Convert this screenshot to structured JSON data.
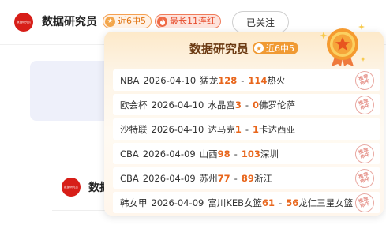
{
  "header": {
    "avatar_text": "数据研究员",
    "username": "数据研究员",
    "streak_badge": "近6中5",
    "longest_badge": "最长11连红",
    "follow_label": "已关注"
  },
  "second_post": {
    "avatar_text": "数据研究员",
    "username": "数据"
  },
  "popover": {
    "title": "数据研究员",
    "badge": "近6中5",
    "records": [
      {
        "league": "NBA",
        "date": "2026-04-10",
        "home": "猛龙",
        "home_score": "128",
        "away_score": "114",
        "away": "热火",
        "stamp": "推荐命中"
      },
      {
        "league": "欧会杯",
        "date": "2026-04-10",
        "home": "水晶宫",
        "home_score": "3",
        "away_score": "0",
        "away": "佛罗伦萨",
        "stamp": "推荐命中"
      },
      {
        "league": "沙特联",
        "date": "2026-04-10",
        "home": "达马克",
        "home_score": "1",
        "away_score": "1",
        "away": "卡达西亚",
        "stamp": ""
      },
      {
        "league": "CBA",
        "date": "2026-04-09",
        "home": "山西",
        "home_score": "98",
        "away_score": "103",
        "away": "深圳",
        "stamp": "推荐命中"
      },
      {
        "league": "CBA",
        "date": "2026-04-09",
        "home": "苏州",
        "home_score": "77",
        "away_score": "89",
        "away": "浙江",
        "stamp": "推荐命中"
      },
      {
        "league": "韩女甲",
        "date": "2026-04-09",
        "home": "富川KEB女篮",
        "home_score": "61",
        "away_score": "56",
        "away": "龙仁三星女篮",
        "stamp": "推荐命中"
      }
    ]
  },
  "colors": {
    "score": "#e8661c",
    "badge_orange": "#f09a33",
    "avatar_red": "#d71e18",
    "title_brown": "#6b3a12"
  },
  "icons": {
    "badge": "star-icon",
    "longest": "flame-icon",
    "medal": "medal-icon",
    "stamp": "hit-stamp-icon"
  }
}
